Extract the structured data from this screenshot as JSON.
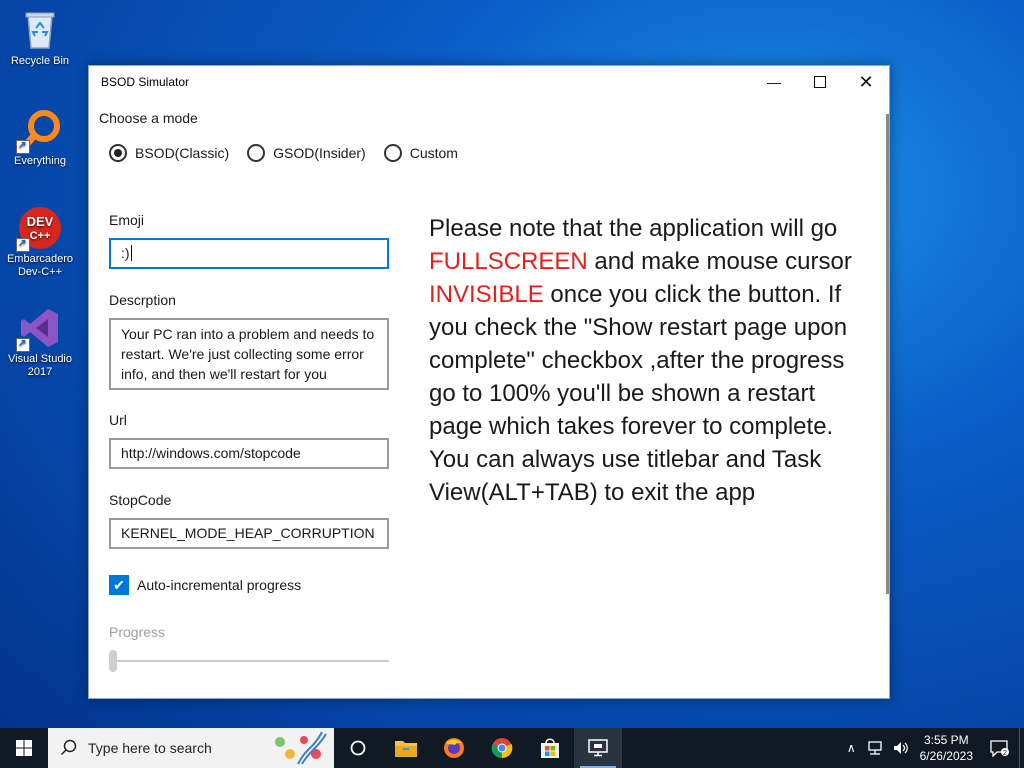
{
  "desktop": {
    "icons": [
      {
        "label": "Recycle Bin"
      },
      {
        "label": "Everything"
      },
      {
        "label": "Embarcadero Dev-C++"
      },
      {
        "label": "Visual Studio 2017"
      }
    ]
  },
  "window": {
    "title": "BSOD Simulator",
    "mode_label": "Choose a mode",
    "modes": [
      {
        "label": "BSOD(Classic)",
        "selected": true
      },
      {
        "label": "GSOD(Insider)",
        "selected": false
      },
      {
        "label": "Custom",
        "selected": false
      }
    ],
    "emoji": {
      "label": "Emoji",
      "value": ":)"
    },
    "description": {
      "label": "Descrption",
      "value": "Your PC ran into a problem and needs to restart. We're just collecting some error info, and then we'll restart for you"
    },
    "url": {
      "label": "Url",
      "value": "http://windows.com/stopcode"
    },
    "stopcode": {
      "label": "StopCode",
      "value": "KERNEL_MODE_HEAP_CORRUPTION"
    },
    "auto_progress": {
      "label": "Auto-incremental progress",
      "checked": true
    },
    "progress": {
      "label": "Progress",
      "value": 0
    },
    "note": {
      "part1": "Please note that the application will go ",
      "red1": "FULLSCREEN",
      "part2": " and make mouse cursor ",
      "red2": "INVISIBLE",
      "part3": " once you click the button. If you check the \"Show restart page upon complete\" checkbox ,after the progress go to 100% you'll be shown a restart page which takes forever to complete. You can always use titlebar and Task View(ALT+TAB) to exit the app"
    }
  },
  "taskbar": {
    "search_placeholder": "Type here to search",
    "time": "3:55 PM",
    "date": "6/26/2023"
  },
  "colors": {
    "accent": "#0078d7",
    "warning_red": "#e3211b"
  }
}
